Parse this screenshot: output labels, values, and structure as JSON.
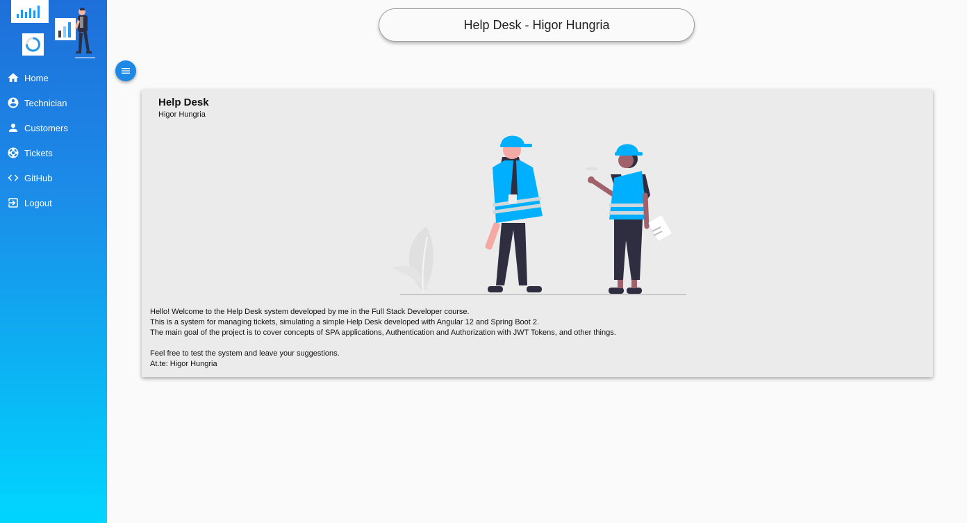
{
  "header": {
    "title": "Help Desk - Higor Hungria"
  },
  "sidebar": {
    "items": [
      {
        "label": "Home",
        "icon": "home-icon"
      },
      {
        "label": "Technician",
        "icon": "account-circle-icon"
      },
      {
        "label": "Customers",
        "icon": "person-icon"
      },
      {
        "label": "Tickets",
        "icon": "lifebuoy-icon"
      },
      {
        "label": "GitHub",
        "icon": "code-icon"
      },
      {
        "label": "Logout",
        "icon": "logout-icon"
      }
    ]
  },
  "card": {
    "title": "Help Desk",
    "subtitle": "Higor Hungria",
    "lines": [
      "Hello! Welcome to the Help Desk system developed by me in the Full Stack Developer course.",
      "This is a system for managing tickets, simulating a simple Help Desk developed with Angular 12 and Spring Boot 2.",
      "The main goal of the project is to cover concepts of SPA applications, Authentication and Authorization with JWT Tokens, and other things.",
      "Feel free to test the system and leave your suggestions.",
      "At.te: Higor Hungria"
    ]
  },
  "colors": {
    "accent": "#1e88e5",
    "sidebar_top": "#1e6fd9",
    "sidebar_bottom": "#00d6ff",
    "vest": "#00b0ff"
  }
}
